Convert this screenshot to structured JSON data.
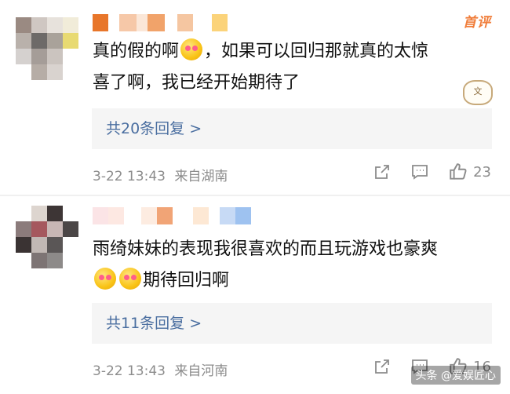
{
  "comments": [
    {
      "badge": "首评",
      "text_line1_a": "真的假的啊",
      "text_line1_b": "，如果可以回归那就真的太惊",
      "text_line2": "喜了啊，我已经开始期待了",
      "replies_label": "共20条回复 >",
      "timestamp": "3-22 13:43",
      "location": "来自湖南",
      "like_count": "23",
      "sticker_text": "文"
    },
    {
      "text_line1": "雨绮妹妹的表现我很喜欢的而且玩游戏也豪爽",
      "text_line2": "期待回归啊",
      "replies_label": "共11条回复 >",
      "timestamp": "3-22 13:43",
      "location": "来自河南",
      "like_count": "16"
    }
  ],
  "watermark": "头条 @爱娱匠心",
  "icons": [
    "share-icon",
    "comment-icon",
    "like-icon",
    "smile-emoji-icon"
  ]
}
